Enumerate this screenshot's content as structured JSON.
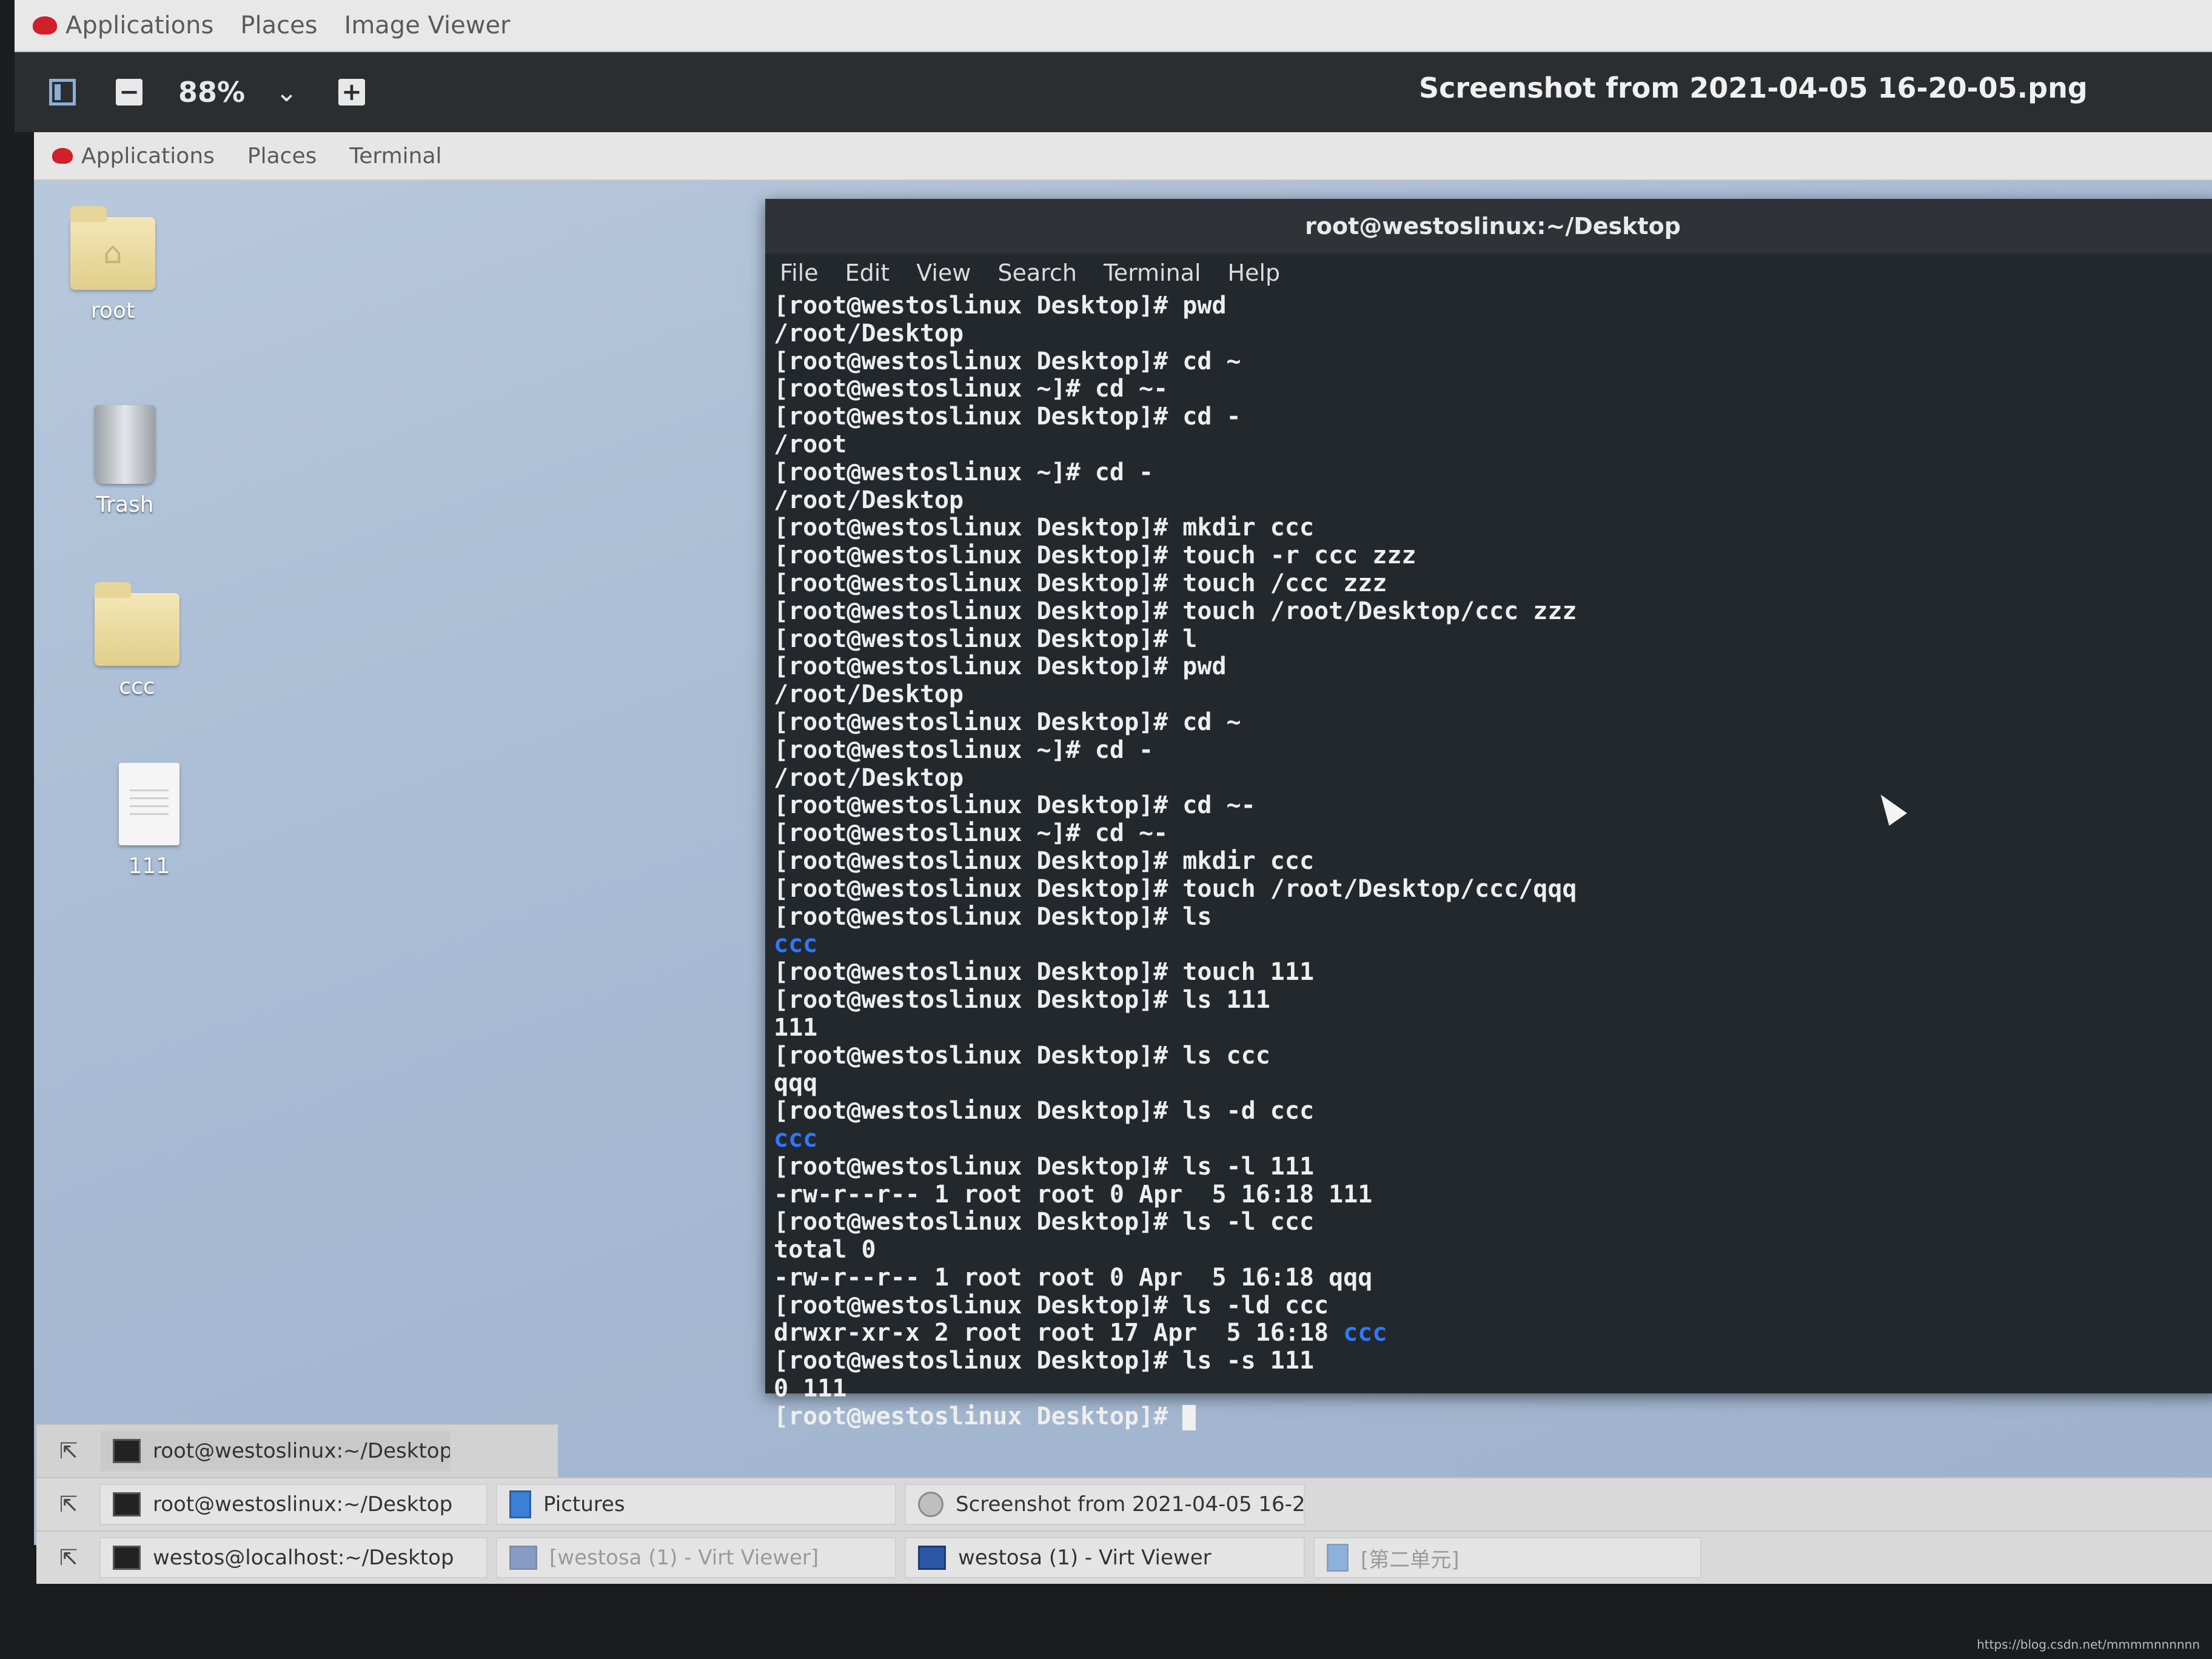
{
  "outer_panel": {
    "applications": "Applications",
    "places": "Places",
    "image_viewer": "Image Viewer"
  },
  "viewer_toolbar": {
    "zoom": "88%",
    "title": "Screenshot from 2021-04-05 16-20-05.png"
  },
  "inner_panel": {
    "applications": "Applications",
    "places": "Places",
    "terminal": "Terminal"
  },
  "desktop_icons": [
    {
      "label": "root",
      "icon": "home-folder-icon"
    },
    {
      "label": "Trash",
      "icon": "trash-icon"
    },
    {
      "label": "ccc",
      "icon": "folder-icon"
    },
    {
      "label": "111",
      "icon": "text-file-icon"
    }
  ],
  "terminal": {
    "title": "root@westoslinux:~/Desktop",
    "menu": [
      "File",
      "Edit",
      "View",
      "Search",
      "Terminal",
      "Help"
    ],
    "lines": [
      "[root@westoslinux Desktop]# pwd",
      "/root/Desktop",
      "[root@westoslinux Desktop]# cd ~",
      "[root@westoslinux ~]# cd ~-",
      "[root@westoslinux Desktop]# cd -",
      "/root",
      "[root@westoslinux ~]# cd -",
      "/root/Desktop",
      "[root@westoslinux Desktop]# mkdir ccc",
      "[root@westoslinux Desktop]# touch -r ccc zzz",
      "[root@westoslinux Desktop]# touch /ccc zzz",
      "[root@westoslinux Desktop]# touch /root/Desktop/ccc zzz",
      "[root@westoslinux Desktop]# l",
      "[root@westoslinux Desktop]# pwd",
      "/root/Desktop",
      "[root@westoslinux Desktop]# cd ~",
      "[root@westoslinux ~]# cd -",
      "/root/Desktop",
      "[root@westoslinux Desktop]# cd ~-",
      "[root@westoslinux ~]# cd ~-",
      "[root@westoslinux Desktop]# mkdir ccc",
      "[root@westoslinux Desktop]# touch /root/Desktop/ccc/qqq",
      "[root@westoslinux Desktop]# ls",
      "ccc",
      "[root@westoslinux Desktop]# touch 111",
      "[root@westoslinux Desktop]# ls 111",
      "111",
      "[root@westoslinux Desktop]# ls ccc",
      "qqq",
      "[root@westoslinux Desktop]# ls -d ccc",
      "ccc",
      "[root@westoslinux Desktop]# ls -l 111",
      "-rw-r--r-- 1 root root 0 Apr  5 16:18 111",
      "[root@westoslinux Desktop]# ls -l ccc",
      "total 0",
      "-rw-r--r-- 1 root root 0 Apr  5 16:18 qqq",
      "[root@westoslinux Desktop]# ls -ld ccc",
      "drwxr-xr-x 2 root root 17 Apr  5 16:18 ",
      "[root@westoslinux Desktop]# ls -s 111",
      "0 111",
      "[root@westoslinux Desktop]# "
    ],
    "blue_suffix_on_line_37": "ccc"
  },
  "taskbars": [
    {
      "tasks": [
        {
          "label": "root@westoslinux:~/Desktop",
          "icon": "terminal-icon"
        }
      ]
    },
    {
      "tasks": [
        {
          "label": "root@westoslinux:~/Desktop",
          "icon": "terminal-icon"
        },
        {
          "label": "Pictures",
          "icon": "folder-icon"
        },
        {
          "label": "Screenshot from 2021-04-05 16-2...",
          "icon": "image-viewer-icon"
        }
      ]
    },
    {
      "tasks": [
        {
          "label": "westos@localhost:~/Desktop",
          "icon": "terminal-icon"
        },
        {
          "label": "[westosa (1) - Virt Viewer]",
          "icon": "monitor-icon"
        },
        {
          "label": "westosa (1) - Virt Viewer",
          "icon": "monitor-icon"
        },
        {
          "label": "[第二单元]",
          "icon": "document-icon"
        }
      ]
    }
  ],
  "watermark": "https://blog.csdn.net/mmmmnnnnnn"
}
